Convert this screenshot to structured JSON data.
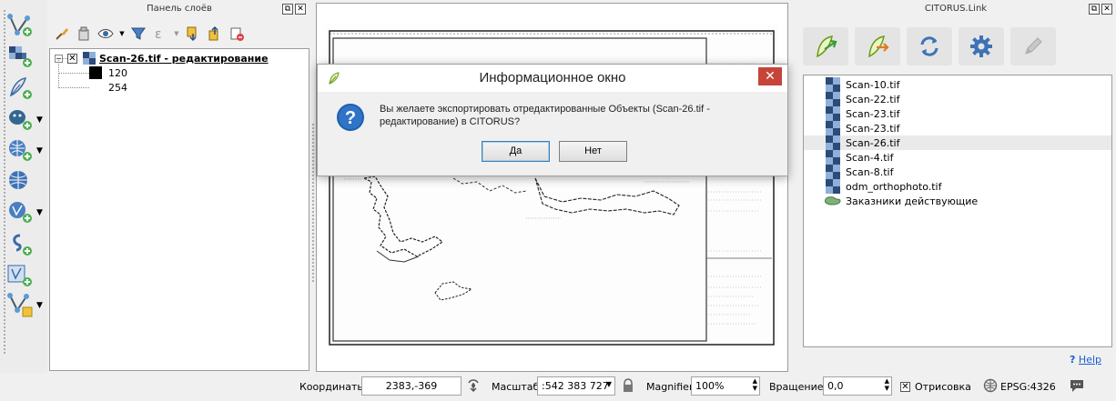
{
  "layers_panel": {
    "title": "Панель слоёв",
    "layer": {
      "name": "Scan-26.tif - редактирование",
      "legend": [
        {
          "value": "120",
          "color": "#000000"
        },
        {
          "value": "254",
          "color": "#ffffff"
        }
      ]
    }
  },
  "citorus_panel": {
    "title": "CITORUS.Link",
    "files": [
      {
        "name": "Scan-10.tif",
        "selected": false
      },
      {
        "name": "Scan-22.tif",
        "selected": false
      },
      {
        "name": "Scan-23.tif",
        "selected": false
      },
      {
        "name": "Scan-23.tif",
        "selected": false
      },
      {
        "name": "Scan-26.tif",
        "selected": true
      },
      {
        "name": "Scan-4.tif",
        "selected": false
      },
      {
        "name": "Scan-8.tif",
        "selected": false
      },
      {
        "name": "odm_orthophoto.tif",
        "selected": false
      },
      {
        "name": "Заказники действующие",
        "selected": false
      }
    ],
    "help": "Help"
  },
  "dialog": {
    "title": "Информационное окно",
    "message": "Вы желаете экспортировать отредактированные Объекты (Scan-26.tif - редактирование) в CITORUS?",
    "yes_label": "Да",
    "no_label": "Нет",
    "close_label": "✕"
  },
  "status_bar": {
    "coords_label": "Координаты",
    "coords_value": "2383,-369",
    "scale_label": "Масштаб",
    "scale_value": ":542 383 727",
    "magnifier_label": "Magnifier",
    "magnifier_value": "100%",
    "rotation_label": "Вращение",
    "rotation_value": "0,0",
    "render_label": "Отрисовка",
    "render_checked": true,
    "crs_label": "EPSG:4326"
  },
  "colors": {
    "accent_close": "#c7443a",
    "link": "#1a5dd6",
    "selection": "#eaeaea"
  }
}
